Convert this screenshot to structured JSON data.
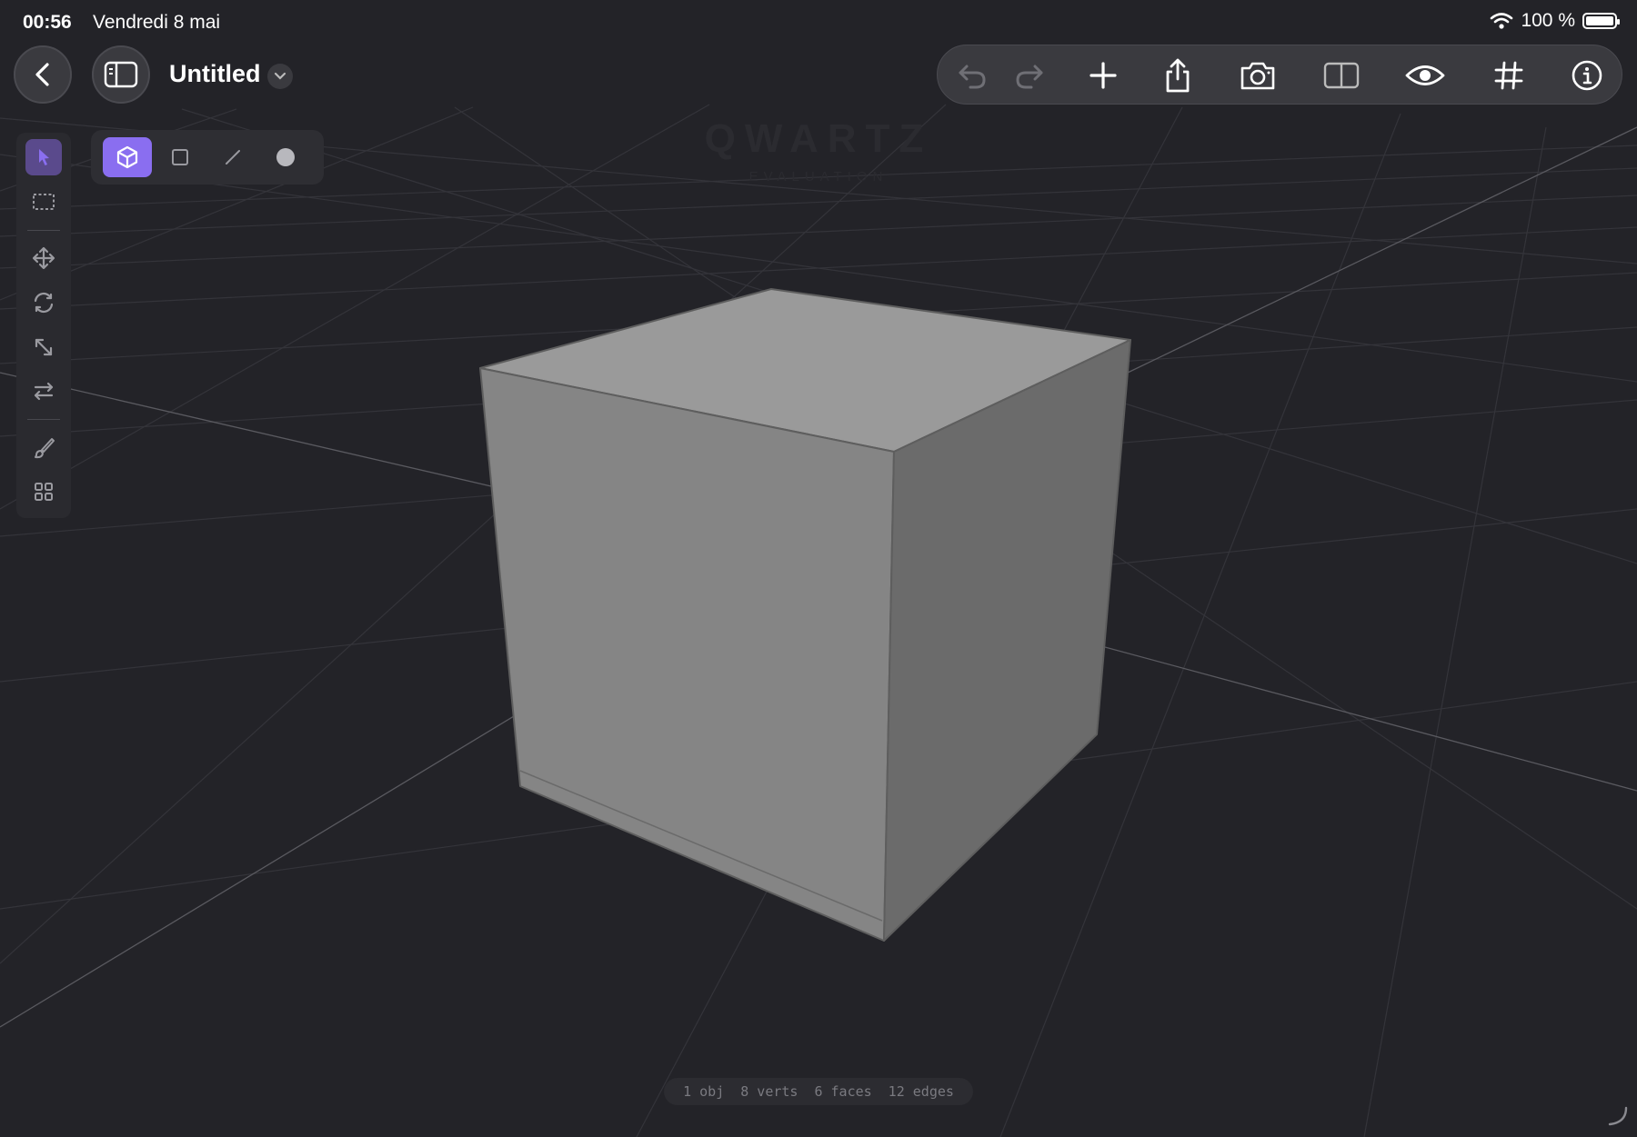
{
  "status_bar": {
    "time": "00:56",
    "date": "Vendredi 8 mai",
    "battery": "100 %"
  },
  "document": {
    "title": "Untitled"
  },
  "toolbar": {
    "buttons": [
      "undo-icon",
      "redo-icon",
      "add-icon",
      "share-icon",
      "camera-icon",
      "split-view-icon",
      "eye-icon",
      "grid-icon",
      "info-icon"
    ]
  },
  "tool_rail": {
    "tools": [
      "select-arrow-icon",
      "marquee-select-icon",
      "move-icon",
      "rotate-icon",
      "scale-icon",
      "mirror-icon",
      "brush-icon",
      "grid-apps-icon"
    ],
    "active_tool": "select-arrow-icon"
  },
  "mode_bar": {
    "modes": [
      "object-mode-icon",
      "face-mode-icon",
      "edge-mode-icon",
      "vertex-mode-icon"
    ],
    "active_mode": "object-mode-icon"
  },
  "watermark": {
    "title": "QWARTZ",
    "subtitle": "EVALUATION"
  },
  "stats": {
    "objects": "1 obj",
    "verts": "8 verts",
    "faces": "6 faces",
    "edges": "12 edges"
  },
  "colors": {
    "background": "#232328",
    "accent": "#8a6ef0",
    "cube_top": "#9a9a9a",
    "cube_front": "#848484",
    "cube_side": "#6b6b6b"
  }
}
